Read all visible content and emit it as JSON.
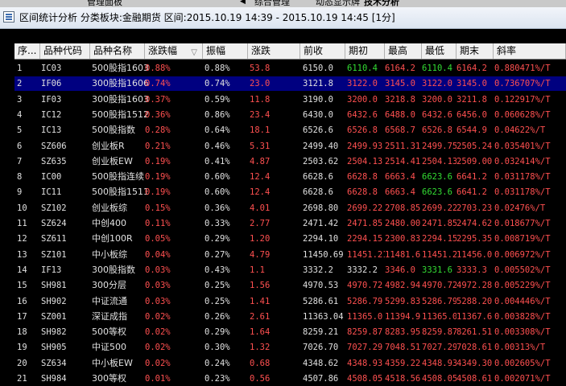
{
  "top_tabs": [
    "管理面板",
    "综合管理",
    "动态显示牌",
    "技术分析"
  ],
  "window": {
    "title": "区间统计分析  分类板块:金融期货  区间:2015.10.19 14:39 - 2015.10.19 14:45  [1分]"
  },
  "columns": [
    "序...",
    "品种代码",
    "品种名称",
    "涨跌幅",
    "振幅",
    "涨跌",
    "前收",
    "期初",
    "最高",
    "最低",
    "期末",
    "斜率"
  ],
  "sort_icon": "▽",
  "rows": [
    {
      "idx": "1",
      "code": "IC03",
      "name": "500股指1603",
      "chg": "0.88%",
      "amp": "0.88%",
      "diff": "53.8",
      "prev": "6150.0",
      "open": "6110.4",
      "high": "6164.2",
      "low": "6110.4",
      "close": "6164.2",
      "slope": "0.880471%/T",
      "oc": "dn",
      "hc": "up",
      "lc": "dn",
      "cc": "up"
    },
    {
      "idx": "2",
      "code": "IF06",
      "name": "300股指1606",
      "chg": "0.74%",
      "amp": "0.74%",
      "diff": "23.0",
      "prev": "3121.8",
      "open": "3122.0",
      "high": "3145.0",
      "low": "3122.0",
      "close": "3145.0",
      "slope": "0.736707%/T",
      "oc": "up",
      "hc": "up",
      "lc": "up",
      "cc": "up"
    },
    {
      "idx": "3",
      "code": "IF03",
      "name": "300股指1603",
      "chg": "0.37%",
      "amp": "0.59%",
      "diff": "11.8",
      "prev": "3190.0",
      "open": "3200.0",
      "high": "3218.8",
      "low": "3200.0",
      "close": "3211.8",
      "slope": "0.122917%/T",
      "oc": "up",
      "hc": "up",
      "lc": "up",
      "cc": "up"
    },
    {
      "idx": "4",
      "code": "IC12",
      "code2": "",
      "name": "500股指1512",
      "chg": "0.36%",
      "amp": "0.86%",
      "diff": "23.4",
      "prev": "6430.0",
      "open": "6432.6",
      "high": "6488.0",
      "low": "6432.6",
      "close": "6456.0",
      "slope": "0.060628%/T",
      "oc": "up",
      "hc": "up",
      "lc": "up",
      "cc": "up"
    },
    {
      "idx": "5",
      "code": "IC13",
      "name": "500股指数",
      "chg": "0.28%",
      "amp": "0.64%",
      "diff": "18.1",
      "prev": "6526.6",
      "open": "6526.8",
      "high": "6568.7",
      "low": "6526.8",
      "close": "6544.9",
      "slope": "0.04622%/T",
      "oc": "up",
      "hc": "up",
      "lc": "up",
      "cc": "up"
    },
    {
      "idx": "6",
      "code": "SZ606",
      "name": "创业板R",
      "chg": "0.21%",
      "amp": "0.46%",
      "diff": "5.31",
      "prev": "2499.40",
      "open": "2499.93",
      "high": "2511.31",
      "low": "2499.75",
      "close": "2505.24",
      "slope": "0.035401%/T",
      "oc": "up",
      "hc": "up",
      "lc": "up",
      "cc": "up"
    },
    {
      "idx": "7",
      "code": "SZ635",
      "name": "创业板EW",
      "chg": "0.19%",
      "amp": "0.41%",
      "diff": "4.87",
      "prev": "2503.62",
      "open": "2504.13",
      "high": "2514.41",
      "low": "2504.13",
      "close": "2509.00",
      "slope": "0.032414%/T",
      "oc": "up",
      "hc": "up",
      "lc": "up",
      "cc": "up"
    },
    {
      "idx": "8",
      "code": "IC00",
      "name": "500股指连续",
      "chg": "0.19%",
      "amp": "0.60%",
      "diff": "12.4",
      "prev": "6628.6",
      "open": "6628.8",
      "high": "6663.4",
      "low": "6623.6",
      "close": "6641.2",
      "slope": "0.031178%/T",
      "oc": "up",
      "hc": "up",
      "lc": "dn",
      "cc": "up"
    },
    {
      "idx": "9",
      "code": "IC11",
      "name": "500股指1511",
      "chg": "0.19%",
      "amp": "0.60%",
      "diff": "12.4",
      "prev": "6628.6",
      "open": "6628.8",
      "high": "6663.4",
      "low": "6623.6",
      "close": "6641.2",
      "slope": "0.031178%/T",
      "oc": "up",
      "hc": "up",
      "lc": "dn",
      "cc": "up"
    },
    {
      "idx": "10",
      "code": "SZ102",
      "name": "创业板综",
      "chg": "0.15%",
      "amp": "0.36%",
      "diff": "4.01",
      "prev": "2698.80",
      "open": "2699.22",
      "high": "2708.85",
      "low": "2699.22",
      "close": "2703.23",
      "slope": "0.02476%/T",
      "oc": "up",
      "hc": "up",
      "lc": "up",
      "cc": "up"
    },
    {
      "idx": "11",
      "code": "SZ624",
      "name": "中创400",
      "chg": "0.11%",
      "amp": "0.33%",
      "diff": "2.77",
      "prev": "2471.42",
      "open": "2471.85",
      "high": "2480.00",
      "low": "2471.85",
      "close": "2474.62",
      "slope": "0.018677%/T",
      "oc": "up",
      "hc": "up",
      "lc": "up",
      "cc": "up"
    },
    {
      "idx": "12",
      "code": "SZ611",
      "name": "中创100R",
      "chg": "0.05%",
      "amp": "0.29%",
      "diff": "1.20",
      "prev": "2294.10",
      "open": "2294.15",
      "high": "2300.83",
      "low": "2294.15",
      "close": "2295.35",
      "slope": "0.008719%/T",
      "oc": "up",
      "hc": "up",
      "lc": "up",
      "cc": "up"
    },
    {
      "idx": "13",
      "code": "SZ101",
      "name": "中小板综",
      "chg": "0.04%",
      "amp": "0.27%",
      "diff": "4.79",
      "prev": "11450.69",
      "open": "11451.21",
      "high": "11481.6",
      "low": "11451.2",
      "close": "11456.0",
      "slope": "0.006972%/T",
      "oc": "up",
      "hc": "up",
      "lc": "up",
      "cc": "up"
    },
    {
      "idx": "14",
      "code": "IF13",
      "name": "300股指数",
      "chg": "0.03%",
      "amp": "0.43%",
      "diff": "1.1",
      "prev": "3332.2",
      "open": "3332.2",
      "high": "3346.0",
      "low": "3331.6",
      "close": "3333.3",
      "slope": "0.005502%/T",
      "oc": "w",
      "hc": "up",
      "lc": "dn",
      "cc": "up"
    },
    {
      "idx": "15",
      "code": "SH981",
      "name": "300分层",
      "chg": "0.03%",
      "amp": "0.25%",
      "diff": "1.56",
      "prev": "4970.53",
      "open": "4970.72",
      "high": "4982.94",
      "low": "4970.72",
      "close": "4972.28",
      "slope": "0.005229%/T",
      "oc": "up",
      "hc": "up",
      "lc": "up",
      "cc": "up"
    },
    {
      "idx": "16",
      "code": "SH902",
      "name": "中证流通",
      "chg": "0.03%",
      "amp": "0.25%",
      "diff": "1.41",
      "prev": "5286.61",
      "open": "5286.79",
      "high": "5299.83",
      "low": "5286.79",
      "close": "5288.20",
      "slope": "0.004446%/T",
      "oc": "up",
      "hc": "up",
      "lc": "up",
      "cc": "up"
    },
    {
      "idx": "17",
      "code": "SZ001",
      "name": "深证成指",
      "chg": "0.02%",
      "amp": "0.26%",
      "diff": "2.61",
      "prev": "11363.04",
      "open": "11365.0",
      "high": "11394.9",
      "low": "11365.0",
      "close": "11367.6",
      "slope": "0.003828%/T",
      "oc": "up",
      "hc": "up",
      "lc": "up",
      "cc": "up"
    },
    {
      "idx": "18",
      "code": "SH982",
      "name": "500等权",
      "chg": "0.02%",
      "amp": "0.29%",
      "diff": "1.64",
      "prev": "8259.21",
      "open": "8259.87",
      "high": "8283.95",
      "low": "8259.87",
      "close": "8261.51",
      "slope": "0.003308%/T",
      "oc": "up",
      "hc": "up",
      "lc": "up",
      "cc": "up"
    },
    {
      "idx": "19",
      "code": "SH905",
      "name": "中证500",
      "chg": "0.02%",
      "amp": "0.30%",
      "diff": "1.32",
      "prev": "7026.70",
      "open": "7027.29",
      "high": "7048.51",
      "low": "7027.29",
      "close": "7028.61",
      "slope": "0.00313%/T",
      "oc": "up",
      "hc": "up",
      "lc": "up",
      "cc": "up"
    },
    {
      "idx": "20",
      "code": "SZ634",
      "name": "中小板EW",
      "chg": "0.02%",
      "amp": "0.24%",
      "diff": "0.68",
      "prev": "4348.62",
      "open": "4348.93",
      "high": "4359.22",
      "low": "4348.93",
      "close": "4349.30",
      "slope": "0.002605%/T",
      "oc": "up",
      "hc": "up",
      "lc": "up",
      "cc": "up"
    },
    {
      "idx": "21",
      "code": "SH984",
      "name": "300等权",
      "chg": "0.01%",
      "amp": "0.23%",
      "diff": "0.56",
      "prev": "4507.86",
      "open": "4508.05",
      "high": "4518.56",
      "low": "4508.05",
      "close": "4508.61",
      "slope": "0.002071%/T",
      "oc": "up",
      "hc": "up",
      "lc": "up",
      "cc": "up"
    }
  ]
}
